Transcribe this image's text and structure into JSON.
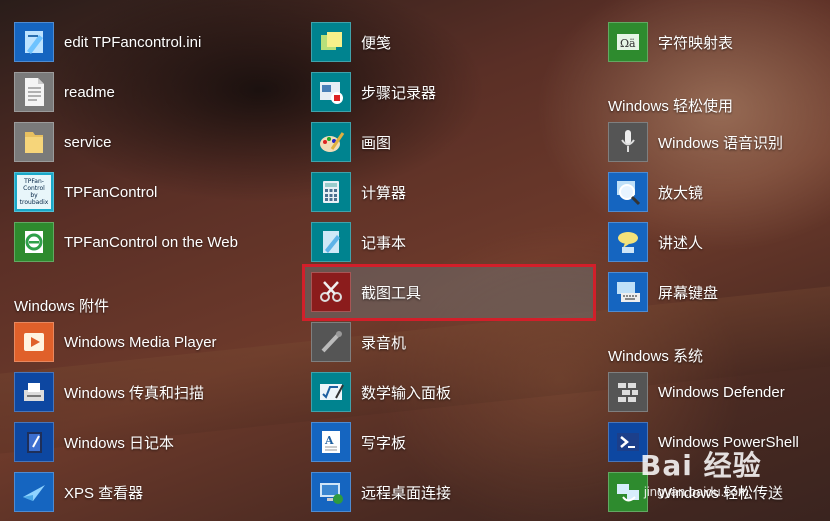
{
  "col1": {
    "tiles": [
      {
        "label": "edit TPFancontrol.ini",
        "icon": "edit-ini-icon"
      },
      {
        "label": "readme",
        "icon": "text-file-icon"
      },
      {
        "label": "service",
        "icon": "folder-icon"
      },
      {
        "label": "TPFanControl",
        "icon": "tpfancontrol-icon",
        "icon_text": "TPFan-\nControl\nby\ntroubadix"
      },
      {
        "label": "TPFanControl on the Web",
        "icon": "web-link-icon"
      }
    ],
    "section_title": "Windows 附件",
    "section_tiles": [
      {
        "label": "Windows Media Player",
        "icon": "media-player-icon"
      },
      {
        "label": "Windows 传真和扫描",
        "icon": "fax-scan-icon"
      },
      {
        "label": "Windows 日记本",
        "icon": "journal-icon"
      },
      {
        "label": "XPS 查看器",
        "icon": "xps-viewer-icon"
      }
    ]
  },
  "col2": {
    "tiles": [
      {
        "label": "便笺",
        "icon": "sticky-notes-icon"
      },
      {
        "label": "步骤记录器",
        "icon": "steps-recorder-icon"
      },
      {
        "label": "画图",
        "icon": "paint-icon"
      },
      {
        "label": "计算器",
        "icon": "calculator-icon"
      },
      {
        "label": "记事本",
        "icon": "notepad-icon"
      },
      {
        "label": "截图工具",
        "icon": "snipping-tool-icon",
        "selected": true
      },
      {
        "label": "录音机",
        "icon": "sound-recorder-icon"
      },
      {
        "label": "数学输入面板",
        "icon": "math-input-icon"
      },
      {
        "label": "写字板",
        "icon": "wordpad-icon"
      },
      {
        "label": "远程桌面连接",
        "icon": "remote-desktop-icon"
      }
    ]
  },
  "col3": {
    "tiles": [
      {
        "label": "字符映射表",
        "icon": "character-map-icon"
      }
    ],
    "section1_title": "Windows 轻松使用",
    "section1_tiles": [
      {
        "label": "Windows 语音识别",
        "icon": "microphone-icon"
      },
      {
        "label": "放大镜",
        "icon": "magnifier-icon"
      },
      {
        "label": "讲述人",
        "icon": "narrator-icon"
      },
      {
        "label": "屏幕键盘",
        "icon": "keyboard-icon"
      }
    ],
    "section2_title": "Windows 系统",
    "section2_tiles": [
      {
        "label": "Windows Defender",
        "icon": "defender-icon"
      },
      {
        "label": "Windows PowerShell",
        "icon": "powershell-icon"
      },
      {
        "label": "Windows 轻松传送",
        "icon": "easy-transfer-icon"
      }
    ]
  },
  "watermark": {
    "brand": "Bai 经验",
    "url": "jingyan.baidu.com"
  },
  "colors": {
    "selection_border": "#d21f2a"
  }
}
